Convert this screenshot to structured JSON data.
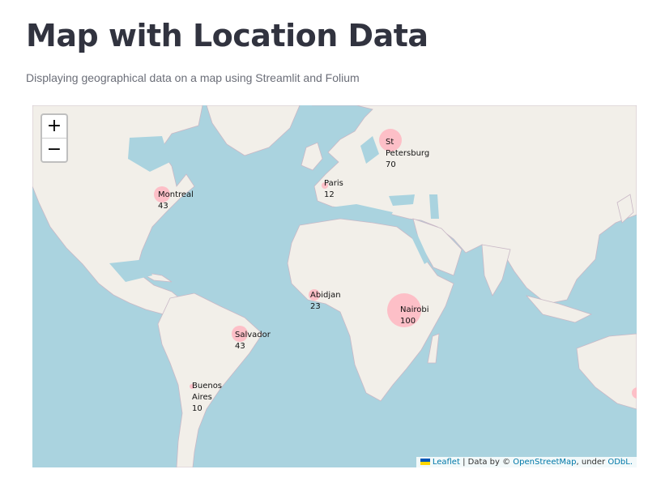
{
  "header": {
    "title": "Map with Location Data",
    "subtitle": "Displaying geographical data on a map using Streamlit and Folium"
  },
  "map": {
    "zoom_in": "+",
    "zoom_out": "−",
    "attribution": {
      "leaflet": "Leaflet",
      "data_by": " | Data by © ",
      "osm": "OpenStreetMap",
      "under": ", under ",
      "odbl": "ODbL."
    },
    "markers": [
      {
        "name": "St Petersburg",
        "value": 70,
        "label": "St\nPetersburg\n70"
      },
      {
        "name": "Paris",
        "value": 12,
        "label": "Paris\n12"
      },
      {
        "name": "Montreal",
        "value": 43,
        "label": "Montreal\n43"
      },
      {
        "name": "Abidjan",
        "value": 23,
        "label": "Abidjan\n23"
      },
      {
        "name": "Nairobi",
        "value": 100,
        "label": "Nairobi\n100"
      },
      {
        "name": "Salvador",
        "value": 43,
        "label": "Salvador\n43"
      },
      {
        "name": "Buenos Aires",
        "value": 10,
        "label": "Buenos\nAires\n10"
      }
    ],
    "colors": {
      "water": "#aad3df",
      "land": "#f2efe9",
      "marker": "#ffb6c1"
    }
  }
}
